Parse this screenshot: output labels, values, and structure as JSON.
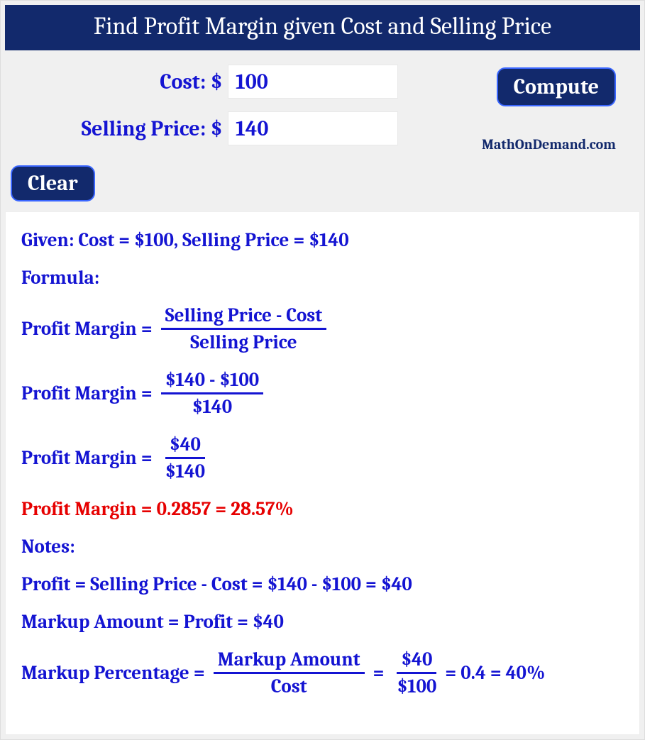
{
  "title": "Find Profit Margin given Cost and Selling Price",
  "inputs": {
    "cost_label": "Cost: $",
    "cost_value": "100",
    "price_label": "Selling Price: $",
    "price_value": "140"
  },
  "buttons": {
    "compute": "Compute",
    "clear": "Clear"
  },
  "brand": "MathOnDemand.com",
  "results": {
    "given": "Given: Cost = $100,  Selling Price = $140",
    "formula_heading": "Formula:",
    "pm_label": "Profit Margin",
    "eq": "=",
    "formula_num": "Selling Price - Cost",
    "formula_den": "Selling Price",
    "step1_num": "$140 - $100",
    "step1_den": "$140",
    "step2_num": "$40",
    "step2_den": "$140",
    "answer": "Profit Margin = 0.2857 = 28.57%",
    "notes_heading": "Notes:",
    "profit_line": "Profit = Selling Price - Cost = $140 - $100 = $40",
    "markup_amount_line": "Markup Amount = Profit = $40",
    "markup_pct_label": "Markup Percentage",
    "markup_pct_num": "Markup Amount",
    "markup_pct_den": "Cost",
    "markup_pct_num2": "$40",
    "markup_pct_den2": "$100",
    "markup_pct_tail": "= 0.4 = 40%"
  }
}
